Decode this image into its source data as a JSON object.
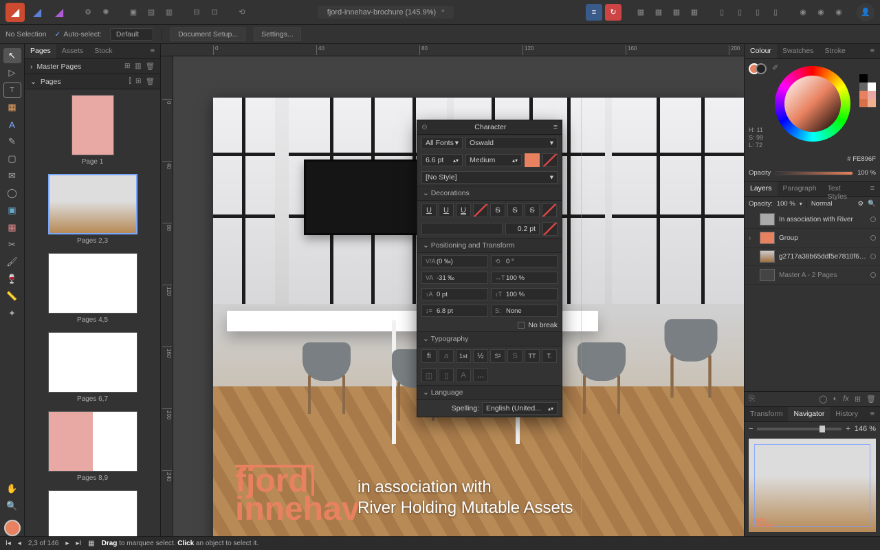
{
  "colors": {
    "accent": "#E8815F",
    "hex": "FE896F"
  },
  "doc": {
    "title": "fjord-innehav-brochure (145.9%)",
    "modified": "*"
  },
  "context": {
    "no_selection": "No Selection",
    "auto_select": "Auto-select:",
    "auto_select_value": "Default",
    "doc_setup": "Document Setup...",
    "settings": "Settings..."
  },
  "pages_panel": {
    "tabs": [
      "Pages",
      "Assets",
      "Stock"
    ],
    "master": "Master Pages",
    "pages_label": "Pages",
    "thumbs": [
      {
        "caption": "Page 1",
        "double": false
      },
      {
        "caption": "Pages 2,3",
        "double": true,
        "selected": true
      },
      {
        "caption": "Pages 4,5",
        "double": true
      },
      {
        "caption": "Pages 6,7",
        "double": true
      },
      {
        "caption": "Pages 8,9",
        "double": true
      }
    ]
  },
  "ruler_h": [
    "0",
    "40",
    "80",
    "120",
    "160",
    "200"
  ],
  "ruler_v": [
    "0",
    "40",
    "80",
    "120",
    "160",
    "200",
    "240"
  ],
  "canvas_text": {
    "logo1": "fjord",
    "logo2": "innehav",
    "assoc1": "in association with",
    "assoc2": "River Holding Mutable Assets"
  },
  "char": {
    "title": "Character",
    "font_filter": "All Fonts",
    "font": "Oswald",
    "size": "6.6 pt",
    "weight": "Medium",
    "style": "[No Style]",
    "sec_deco": "Decorations",
    "deco_val": "0.2 pt",
    "sec_pos": "Positioning and Transform",
    "tracking": "(0 ‰)",
    "rotation": "0 °",
    "va": "-31 ‰",
    "scale_h": "100 %",
    "baseline": "0 pt",
    "scale_v": "100 %",
    "leading": "6.8 pt",
    "shear": "None",
    "no_break": "No break",
    "sec_typo": "Typography",
    "typo": [
      "fi",
      "a",
      "1st",
      "½",
      "S¹",
      "S",
      "TT",
      "T."
    ],
    "sec_lang": "Language",
    "spelling_label": "Spelling:",
    "spelling": "English (United..."
  },
  "right": {
    "colour_tabs": [
      "Colour",
      "Swatches",
      "Stroke"
    ],
    "hsl": {
      "h": "H: 11",
      "s": "S: 99",
      "l": "L: 72"
    },
    "hex_prefix": "#",
    "opacity_label": "Opacity",
    "opacity_value": "100 %",
    "layer_tabs": [
      "Layers",
      "Paragraph",
      "Text Styles"
    ],
    "layer_opacity": "Opacity:",
    "layer_opacity_val": "100 %",
    "blend": "Normal",
    "layers": [
      {
        "label": "In association with River"
      },
      {
        "label": "Group"
      },
      {
        "label": "g2717a38b65ddf5e7810f648..."
      },
      {
        "label": "Master A - 2 Pages"
      }
    ],
    "nav_tabs": [
      "Transform",
      "Navigator",
      "History"
    ],
    "zoom": "146 %"
  },
  "status": {
    "page": "2,3 of 146",
    "hint_drag": "Drag",
    "hint_drag_txt": " to marquee select. ",
    "hint_click": "Click",
    "hint_click_txt": " an object to select it."
  }
}
